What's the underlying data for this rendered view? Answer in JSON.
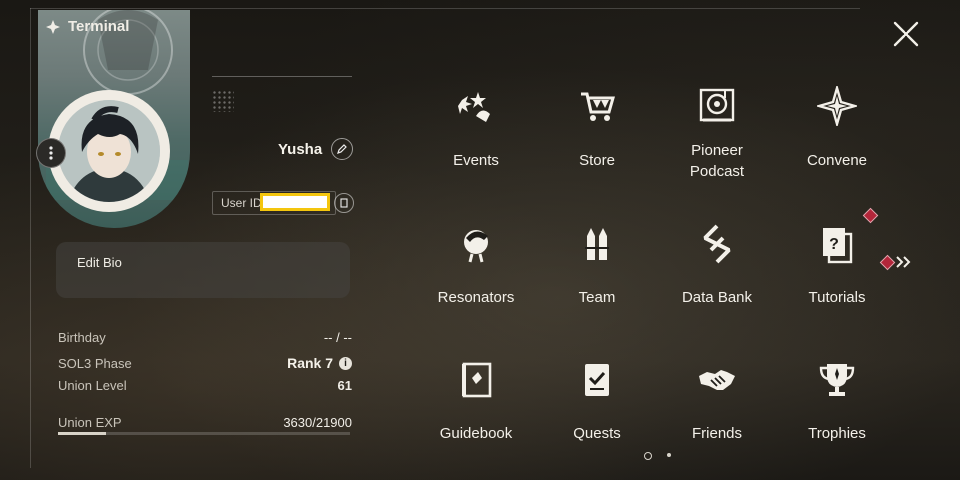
{
  "header": {
    "title": "Terminal"
  },
  "profile": {
    "username": "Yusha",
    "user_id_label": "User ID",
    "user_id_value": "",
    "bio_label": "Edit Bio"
  },
  "stats": [
    {
      "label": "Birthday",
      "value": "-- / --"
    },
    {
      "label": "SOL3 Phase",
      "value": "Rank 7"
    },
    {
      "label": "Union Level",
      "value": "61"
    },
    {
      "label": "Union EXP",
      "value": "3630/21900"
    }
  ],
  "union_exp_progress": 0.166,
  "menu": [
    {
      "label": "Events",
      "icon": "events-icon"
    },
    {
      "label": "Store",
      "icon": "cart-icon"
    },
    {
      "label": "Pioneer\nPodcast",
      "icon": "podcast-icon"
    },
    {
      "label": "Convene",
      "icon": "convene-icon"
    },
    {
      "label": "Resonators",
      "icon": "resonator-icon"
    },
    {
      "label": "Team",
      "icon": "team-icon"
    },
    {
      "label": "Data Bank",
      "icon": "databank-icon"
    },
    {
      "label": "Tutorials",
      "icon": "tutorials-icon"
    },
    {
      "label": "Guidebook",
      "icon": "guidebook-icon"
    },
    {
      "label": "Quests",
      "icon": "quests-icon"
    },
    {
      "label": "Friends",
      "icon": "handshake-icon"
    },
    {
      "label": "Trophies",
      "icon": "trophy-icon"
    }
  ],
  "colors": {
    "alert": "#b3263a",
    "highlight": "#f4c60e",
    "text": "#f3f0e9"
  }
}
